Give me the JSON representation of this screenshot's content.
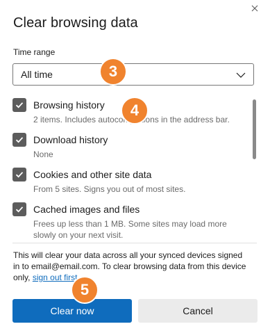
{
  "dialog": {
    "title": "Clear browsing data",
    "close_icon": "close-icon"
  },
  "time_range": {
    "label": "Time range",
    "selected": "All time"
  },
  "options": [
    {
      "label": "Browsing history",
      "description": "2 items. Includes autocompletions in the address bar.",
      "checked": true
    },
    {
      "label": "Download history",
      "description": "None",
      "checked": true
    },
    {
      "label": "Cookies and other site data",
      "description": "From 5 sites. Signs you out of most sites.",
      "checked": true
    },
    {
      "label": "Cached images and files",
      "description": "Frees up less than 1 MB. Some sites may load more slowly on your next visit.",
      "checked": true
    }
  ],
  "info": {
    "text": "This will clear your data across all your synced devices signed in to email@email.com.  To clear browsing data from this device only,",
    "link": "sign out first",
    "suffix": "."
  },
  "buttons": {
    "clear_now": "Clear now",
    "cancel": "Cancel"
  },
  "step_badges": [
    "3",
    "4",
    "5"
  ],
  "colors": {
    "primary": "#0f6cbd",
    "badge": "#f0832e",
    "checkbox": "#5c5c5c"
  }
}
